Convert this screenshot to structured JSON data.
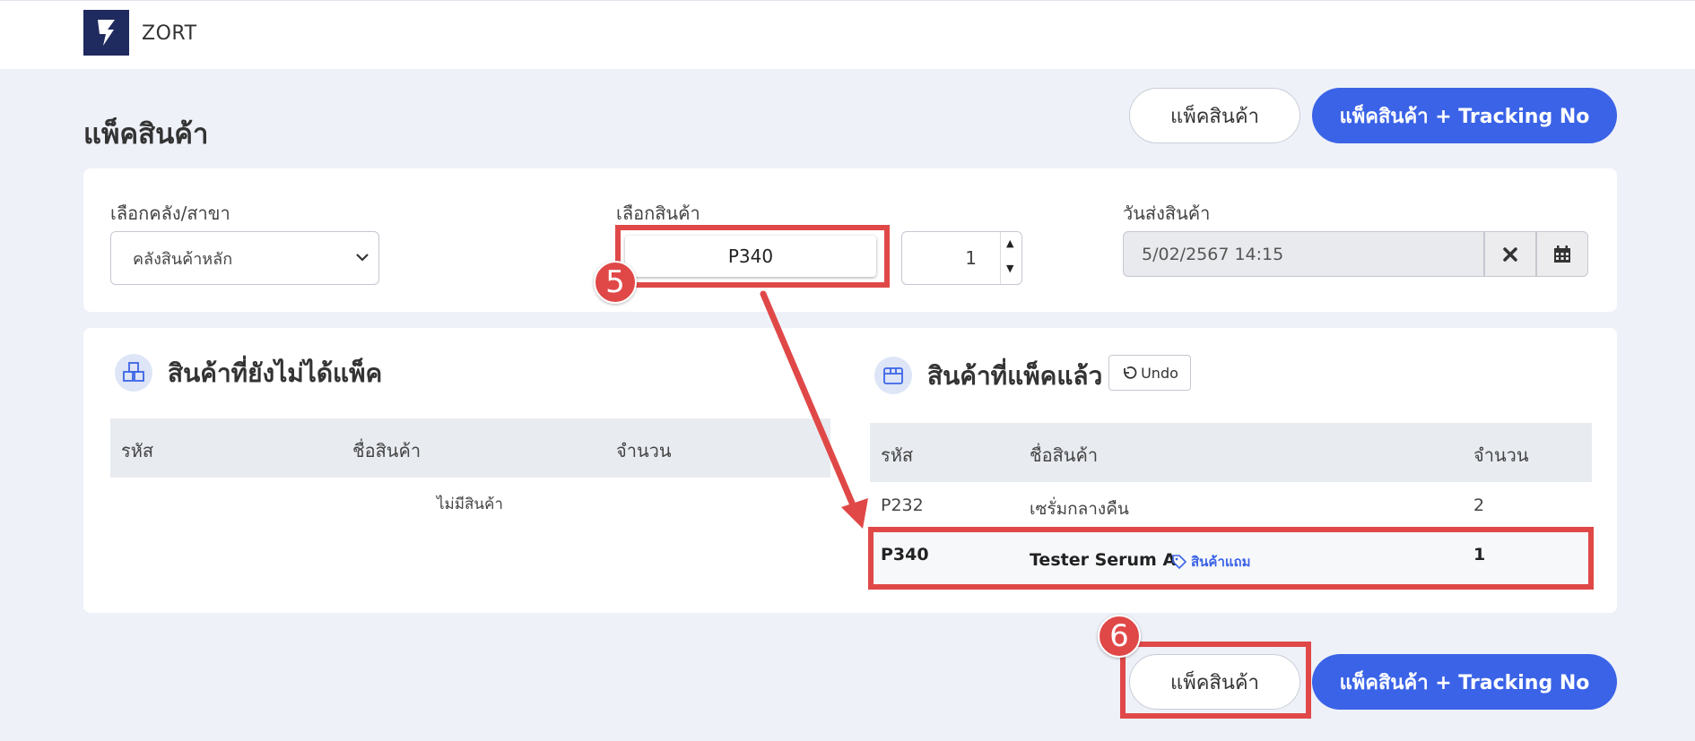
{
  "brand": {
    "name": "ZORT"
  },
  "page": {
    "title": "แพ็คสินค้า"
  },
  "top_actions": {
    "pack_label": "แพ็คสินค้า",
    "pack_tracking_label": "แพ็คสินค้า + Tracking No"
  },
  "form": {
    "warehouse_label": "เลือกคลัง/สาขา",
    "warehouse_value": "คลังสินค้าหลัก",
    "product_label": "เลือกสินค้า",
    "product_value": "P340",
    "quantity_value": "1",
    "ship_date_label": "วันส่งสินค้า",
    "ship_date_value": "5/02/2567 14:15"
  },
  "unpacked": {
    "title": "สินค้าที่ยังไม่ได้แพ็ค",
    "columns": [
      "รหัส",
      "ชื่อสินค้า",
      "จำนวน"
    ],
    "empty_text": "ไม่มีสินค้า"
  },
  "packed": {
    "title": "สินค้าที่แพ็คแล้ว",
    "undo_label": "Undo",
    "columns": [
      "รหัส",
      "ชื่อสินค้า",
      "จำนวน"
    ],
    "rows": [
      {
        "code": "P232",
        "name": "เซรั่มกลางคืน",
        "qty": "2"
      },
      {
        "code": "P340",
        "name": "Tester Serum A",
        "tag": "สินค้าแถม",
        "qty": "1"
      }
    ]
  },
  "bottom_actions": {
    "pack_label": "แพ็คสินค้า",
    "pack_tracking_label": "แพ็คสินค้า + Tracking No"
  },
  "annotations": {
    "step5": "5",
    "step6": "6"
  },
  "colors": {
    "primary": "#3b63e7",
    "annotation": "#e04848",
    "logo_bg": "#1f2a5e"
  }
}
